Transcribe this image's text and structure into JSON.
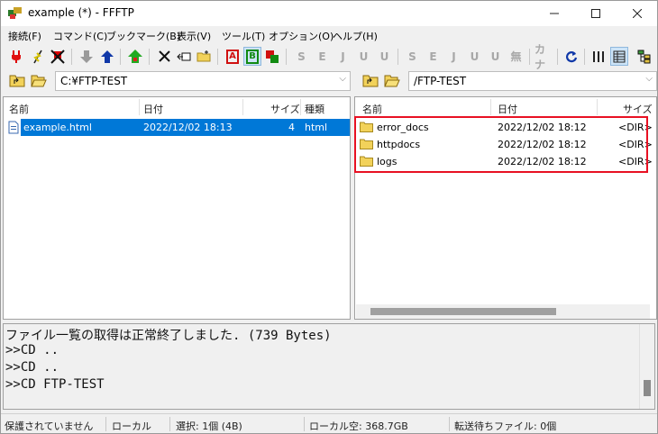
{
  "window": {
    "title": "example (*) - FFFTP"
  },
  "menu": [
    "接続(F)",
    "コマンド(C)",
    "ブックマーク(B)",
    "表示(V)",
    "ツール(T)",
    "オプション(O)",
    "ヘルプ(H)"
  ],
  "toolbar": {
    "kanji_label": "S",
    "euc_label": "E",
    "jis_label": "J",
    "utf8_label": "U",
    "utf8bom_label": "U",
    "none_label": "無",
    "kana_label": "カナ",
    "ascii_label": "A",
    "binary_label": "B"
  },
  "local": {
    "path": "C:¥FTP-TEST",
    "columns": {
      "name": "名前",
      "date": "日付",
      "size": "サイズ",
      "type": "種類"
    },
    "files": [
      {
        "name": "example.html",
        "date": "2022/12/02 18:13",
        "size": "4",
        "type": "html"
      }
    ]
  },
  "remote": {
    "path": "/FTP-TEST",
    "columns": {
      "name": "名前",
      "date": "日付",
      "size": "サイズ"
    },
    "files": [
      {
        "name": "error_docs",
        "date": "2022/12/02 18:12",
        "size": "<DIR>"
      },
      {
        "name": "httpdocs",
        "date": "2022/12/02 18:12",
        "size": "<DIR>"
      },
      {
        "name": "logs",
        "date": "2022/12/02 18:12",
        "size": "<DIR>"
      }
    ]
  },
  "log": [
    "ファイル一覧の取得は正常終了しました. (739 Bytes)",
    ">>CD ..",
    ">>CD ..",
    ">>CD FTP-TEST"
  ],
  "status": {
    "protection": "保護されていません",
    "local": "ローカル",
    "selection": "選択: 1個 (4B)",
    "local_free": "ローカル空: 368.7GB",
    "queue": "転送待ちファイル: 0個"
  },
  "colors": {
    "selection": "#0078d7",
    "highlight": "#e81123"
  }
}
